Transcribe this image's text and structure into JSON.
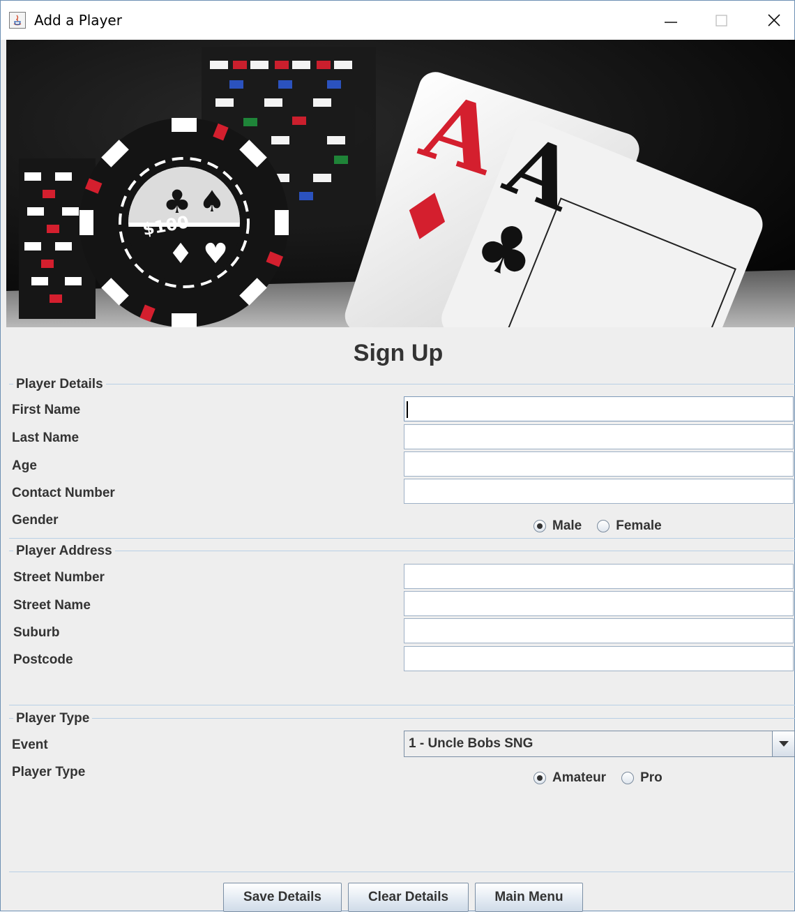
{
  "window": {
    "title": "Add a Player"
  },
  "heading": "Sign Up",
  "player_details": {
    "title": "Player Details",
    "fields": [
      {
        "label": "First Name",
        "value": ""
      },
      {
        "label": "Last Name",
        "value": ""
      },
      {
        "label": "Age",
        "value": ""
      },
      {
        "label": "Contact Number",
        "value": ""
      }
    ],
    "gender": {
      "label": "Gender",
      "options": [
        "Male",
        "Female"
      ],
      "selected": "Male"
    }
  },
  "player_address": {
    "title": "Player Address",
    "fields": [
      {
        "label": "Street Number",
        "value": ""
      },
      {
        "label": "Street Name",
        "value": ""
      },
      {
        "label": "Suburb",
        "value": ""
      },
      {
        "label": "Postcode",
        "value": ""
      }
    ]
  },
  "player_type": {
    "title": "Player Type",
    "event": {
      "label": "Event",
      "selected": "1 - Uncle Bobs SNG"
    },
    "type": {
      "label": "Player Type",
      "options": [
        "Amateur",
        "Pro"
      ],
      "selected": "Amateur"
    }
  },
  "buttons": {
    "save": "Save Details",
    "clear": "Clear Details",
    "main_menu": "Main Menu"
  },
  "banner": {
    "chip_value": "$100",
    "card_rank": "A"
  },
  "colors": {
    "card_red": "#d41f2e",
    "panel_bg": "#eeeeee",
    "border_accent": "#b8cfe5"
  }
}
